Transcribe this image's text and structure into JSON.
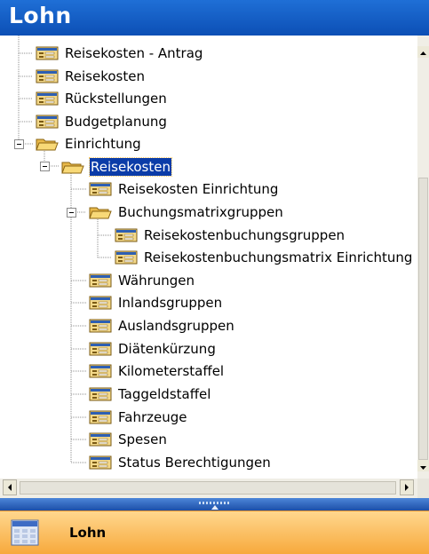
{
  "window": {
    "title": "Lohn"
  },
  "tree": {
    "items": [
      {
        "label": "Reisekosten - Antrag",
        "icon": "form-icon",
        "depth": 0
      },
      {
        "label": "Reisekosten",
        "icon": "form-icon",
        "depth": 0
      },
      {
        "label": "Rückstellungen",
        "icon": "form-icon",
        "depth": 0
      },
      {
        "label": "Budgetplanung",
        "icon": "form-icon",
        "depth": 0
      },
      {
        "label": "Einrichtung",
        "icon": "folder-open-icon",
        "depth": 0,
        "expanded": true
      },
      {
        "label": "Reisekosten",
        "icon": "folder-open-icon",
        "depth": 1,
        "expanded": true,
        "selected": true
      },
      {
        "label": "Reisekosten Einrichtung",
        "icon": "form-icon",
        "depth": 2
      },
      {
        "label": "Buchungsmatrixgruppen",
        "icon": "folder-open-icon",
        "depth": 2,
        "expanded": true
      },
      {
        "label": "Reisekostenbuchungsgruppen",
        "icon": "form-icon",
        "depth": 3
      },
      {
        "label": "Reisekostenbuchungsmatrix Einrichtung",
        "icon": "form-icon",
        "depth": 3
      },
      {
        "label": "Währungen",
        "icon": "form-icon",
        "depth": 2
      },
      {
        "label": "Inlandsgruppen",
        "icon": "form-icon",
        "depth": 2
      },
      {
        "label": "Auslandsgruppen",
        "icon": "form-icon",
        "depth": 2
      },
      {
        "label": "Diätenkürzung",
        "icon": "form-icon",
        "depth": 2
      },
      {
        "label": "Kilometerstaffel",
        "icon": "form-icon",
        "depth": 2
      },
      {
        "label": "Taggeldstaffel",
        "icon": "form-icon",
        "depth": 2
      },
      {
        "label": "Fahrzeuge",
        "icon": "form-icon",
        "depth": 2
      },
      {
        "label": "Spesen",
        "icon": "form-icon",
        "depth": 2
      },
      {
        "label": "Status Berechtigungen",
        "icon": "form-icon",
        "depth": 2
      }
    ]
  },
  "bottom_nav": {
    "label": "Lohn",
    "icon": "lohn-module-icon"
  },
  "colors": {
    "title_bar": "#0c4fb5",
    "selection": "#0b3ca8",
    "bottom_bar": "#f7a93c"
  }
}
